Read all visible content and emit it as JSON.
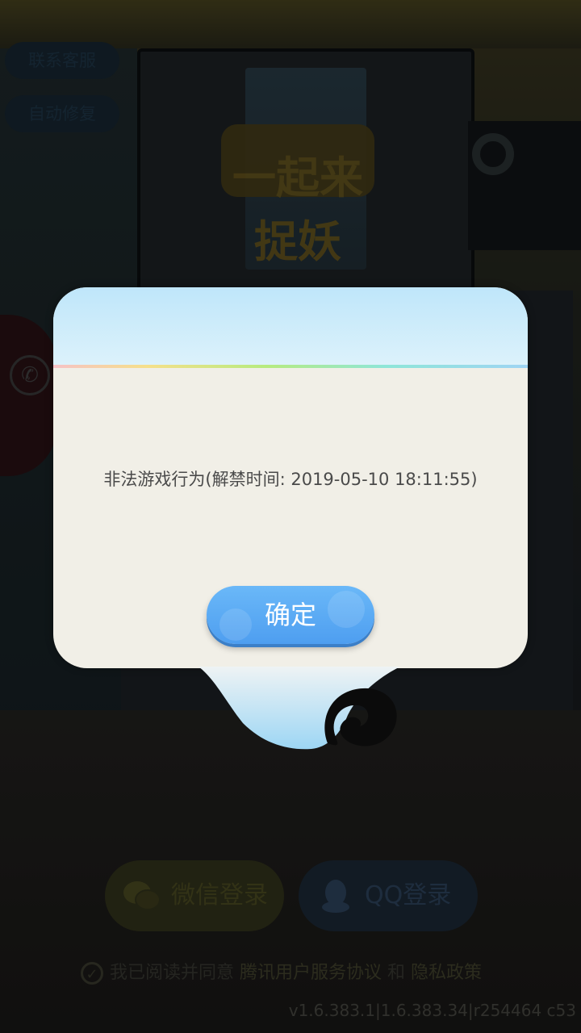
{
  "background": {
    "service_button": "联系客服",
    "auto_repair_button": "自动修复",
    "game_logo_text": "一起来捉妖",
    "wechat_login": "微信登录",
    "qq_login": "QQ登录",
    "agree_prefix": "我已阅读并同意",
    "agree_user_agreement": "腾讯用户服务协议",
    "agree_and": "和",
    "agree_privacy_policy": "隐私政策",
    "version": "v1.6.383.1|1.6.383.34|r254464 c53"
  },
  "dialog": {
    "message": "非法游戏行为(解禁时间: 2019-05-10 18:11:55)",
    "confirm_label": "确定"
  },
  "colors": {
    "dialog_body": "#f1efe7",
    "dialog_header": "#bfe6fa",
    "confirm_button": "#5aaaf5"
  },
  "icons": {
    "wechat": "wechat-icon",
    "qq": "qq-icon",
    "check": "check-icon"
  }
}
